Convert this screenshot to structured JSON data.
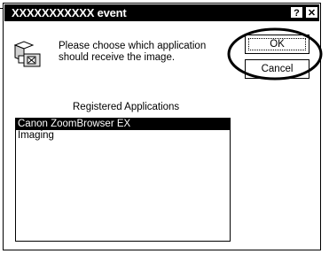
{
  "window": {
    "title": "XXXXXXXXXXX event",
    "help_label": "?",
    "close_label": "✕"
  },
  "message": "Please choose which application should receive the image.",
  "buttons": {
    "ok_label": "OK",
    "cancel_label": "Cancel"
  },
  "list": {
    "heading": "Registered Applications",
    "items": [
      {
        "label": "Canon ZoomBrowser EX",
        "selected": true
      },
      {
        "label": "Imaging",
        "selected": false
      }
    ]
  },
  "icons": {
    "app": "scanner-camera-icon"
  }
}
